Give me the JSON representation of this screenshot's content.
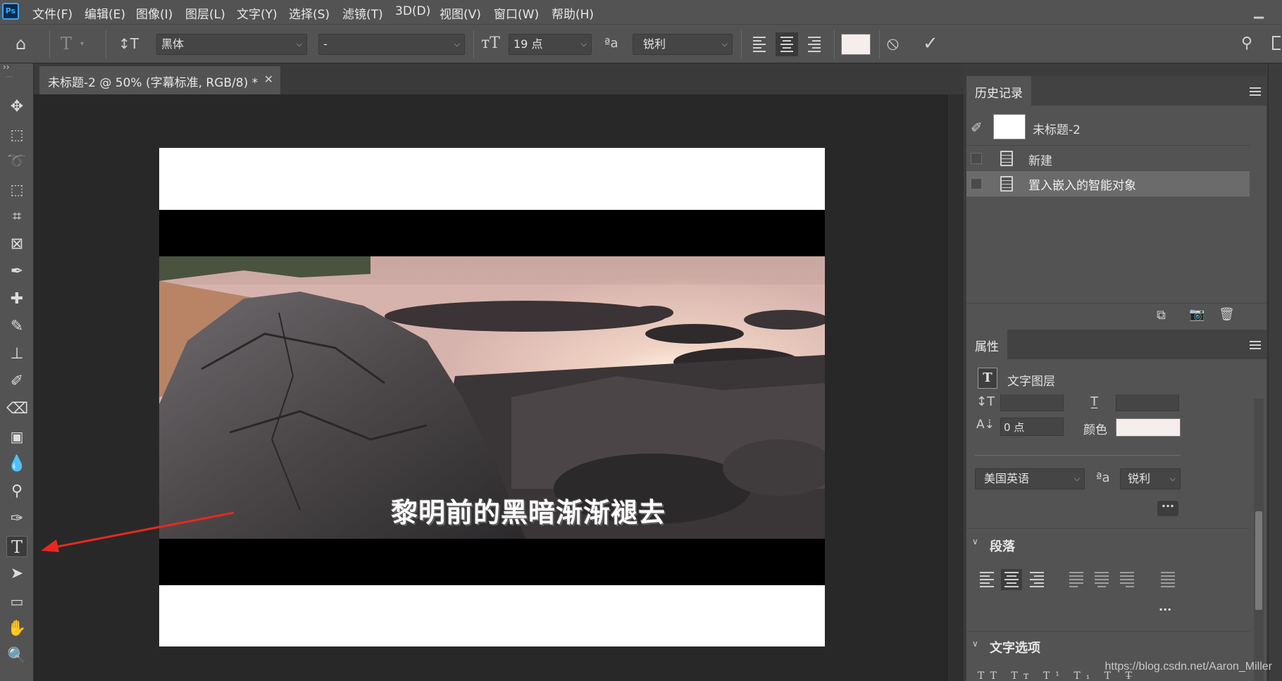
{
  "menu": {
    "logo": "Ps",
    "items": [
      "文件(F)",
      "编辑(E)",
      "图像(I)",
      "图层(L)",
      "文字(Y)",
      "选择(S)",
      "滤镜(T)",
      "3D(D)",
      "视图(V)",
      "窗口(W)",
      "帮助(H)"
    ]
  },
  "options": {
    "font_family": "黑体",
    "font_style": "-",
    "font_size": "19 点",
    "antialias": "锐利",
    "text_color": "#f6eded"
  },
  "document": {
    "tab_title": "未标题-2 @ 50% (字幕标准, RGB/8) *",
    "caption": "黎明前的黑暗渐渐褪去"
  },
  "history_panel": {
    "tab": "历史记录",
    "snapshot": "未标题-2",
    "steps": [
      "新建",
      "置入嵌入的智能对象"
    ]
  },
  "properties_panel": {
    "tab": "属性",
    "layer_kind": "文字图层",
    "tracking_value": "0 点",
    "color_label": "颜色",
    "language": "美国英语",
    "antialias": "锐利",
    "paragraph_section": "段落",
    "text_options_section": "文字选项"
  },
  "watermark": "https://blog.csdn.net/Aaron_Miller",
  "colors": {
    "ui_panel": "#535353",
    "ui_dark": "#282828",
    "arrow": "#e8281e"
  }
}
